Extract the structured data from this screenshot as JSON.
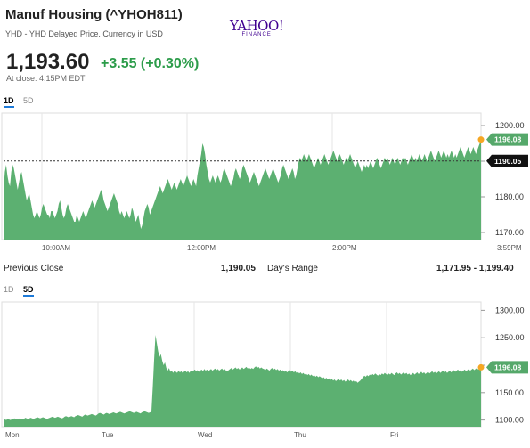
{
  "header": {
    "title": "Manuf Housing (^YHOH811)",
    "subtitle": "YHD - YHD Delayed Price. Currency in USD",
    "logo_main": "YAHOO!",
    "logo_sub": "FINANCE"
  },
  "quote": {
    "price": "1,193.60",
    "change": "+3.55 (+0.30%)",
    "close_text": "At close: 4:15PM EDT"
  },
  "tabs_top": [
    "1D",
    "5D"
  ],
  "tabs_bottom": [
    "1D",
    "5D"
  ],
  "stats": {
    "prev_close_label": "Previous Close",
    "prev_close_value": "1,190.05",
    "days_range_label": "Day's Range",
    "days_range_value": "1,171.95 - 1,199.40"
  },
  "colors": {
    "fill": "#5cb071",
    "positive": "#2c9c4a",
    "tab_accent": "#1d7ad8",
    "marker": "#f5a623",
    "label_bg": "#55a86a"
  },
  "chart_data": [
    {
      "type": "area",
      "range_label": "1D",
      "x_tick_labels": [
        "10:00AM",
        "12:00PM",
        "2:00PM",
        "3:59PM"
      ],
      "y_tick_labels": [
        "1200.00",
        "1190.00",
        "1180.00",
        "1170.00"
      ],
      "ylim": [
        1168,
        1203
      ],
      "last_value_label": "1196.08",
      "prev_close_label": "1190.05",
      "prev_close": 1190.05,
      "x": [
        0,
        1,
        2,
        3,
        4,
        5,
        6,
        7,
        8,
        9,
        10,
        11,
        12,
        13,
        14,
        15,
        16,
        17,
        18,
        19,
        20,
        21,
        22,
        23,
        24,
        25,
        26,
        27,
        28,
        29,
        30,
        31,
        32,
        33,
        34,
        35,
        36,
        37,
        38,
        39,
        40,
        41,
        42,
        43,
        44,
        45,
        46,
        47,
        48,
        49,
        50,
        51,
        52,
        53,
        54,
        55,
        56,
        57,
        58,
        59,
        60,
        61,
        62,
        63,
        64,
        65,
        66,
        67,
        68,
        69,
        70,
        71,
        72,
        73,
        74,
        75,
        76,
        77,
        78,
        79,
        80,
        81,
        82,
        83,
        84,
        85,
        86,
        87,
        88,
        89,
        90,
        91,
        92,
        93,
        94,
        95,
        96,
        97,
        98,
        99,
        100,
        101,
        102,
        103,
        104,
        105,
        106,
        107,
        108,
        109,
        110,
        111,
        112,
        113,
        114,
        115,
        116,
        117,
        118,
        119,
        120,
        121,
        122,
        123,
        124,
        125,
        126,
        127,
        128,
        129,
        130,
        131,
        132,
        133,
        134,
        135,
        136,
        137,
        138,
        139,
        140,
        141,
        142,
        143,
        144,
        145,
        146,
        147,
        148,
        149,
        150,
        151,
        152,
        153,
        154,
        155,
        156,
        157,
        158,
        159,
        160,
        161,
        162,
        163,
        164,
        165,
        166,
        167,
        168,
        169,
        170,
        171,
        172,
        173,
        174,
        175,
        176,
        177,
        178,
        179,
        180,
        181,
        182,
        183,
        184,
        185,
        186,
        187,
        188,
        189,
        190,
        191,
        192,
        193,
        194,
        195,
        196,
        197,
        198,
        199,
        200,
        201,
        202,
        203,
        204,
        205,
        206,
        207,
        208,
        209,
        210,
        211,
        212,
        213,
        214,
        215,
        216,
        217,
        218,
        219,
        220,
        221,
        222,
        223,
        224,
        225,
        226,
        227,
        228,
        229,
        230,
        231,
        232,
        233,
        234,
        235,
        236,
        237,
        238,
        239,
        240,
        241,
        242,
        243,
        244,
        245,
        246,
        247,
        248,
        249,
        250,
        251,
        252,
        253,
        254,
        255,
        256,
        257,
        258,
        259,
        260,
        261,
        262,
        263,
        264,
        265,
        266,
        267,
        268,
        269,
        270,
        271,
        272,
        273,
        274,
        275,
        276,
        277,
        278,
        279,
        280,
        281,
        282,
        283,
        284,
        285,
        286,
        287,
        288,
        289,
        290,
        291,
        292,
        293,
        294,
        295,
        296,
        297,
        298,
        299,
        300,
        301,
        302,
        303,
        304,
        305,
        306,
        307,
        308,
        309,
        310,
        311,
        312,
        313,
        314,
        315,
        316,
        317,
        318,
        319,
        320,
        321,
        322,
        323,
        324,
        325,
        326,
        327,
        328,
        329,
        330,
        331,
        332,
        333,
        334,
        335,
        336,
        337,
        338,
        339,
        340,
        341,
        342,
        343,
        344,
        345,
        346,
        347,
        348,
        349,
        350,
        351,
        352,
        353,
        354,
        355,
        356,
        357,
        358,
        359,
        360,
        361,
        362,
        363,
        364,
        365,
        366,
        367,
        368,
        369,
        370,
        371,
        372,
        373,
        374,
        375,
        376,
        377,
        378,
        379,
        380,
        381,
        382,
        383,
        384,
        385,
        386,
        387,
        388,
        389,
        390
      ],
      "values": [
        1182,
        1187,
        1189,
        1186,
        1184,
        1183,
        1187,
        1189,
        1188,
        1186,
        1184,
        1182,
        1184,
        1186,
        1187,
        1185,
        1183,
        1181,
        1179,
        1180,
        1181,
        1179,
        1177,
        1175,
        1174,
        1175,
        1176,
        1175,
        1174,
        1175,
        1177,
        1178,
        1177,
        1176,
        1175,
        1175,
        1174,
        1176,
        1176,
        1175,
        1174,
        1175,
        1176,
        1178,
        1179,
        1177,
        1175,
        1174,
        1175,
        1177,
        1178,
        1177,
        1176,
        1175,
        1174,
        1173,
        1173,
        1175,
        1174,
        1173,
        1174,
        1175,
        1176,
        1175,
        1174,
        1175,
        1176,
        1177,
        1178,
        1179,
        1178,
        1177,
        1178,
        1179,
        1180,
        1181,
        1182,
        1181,
        1179,
        1178,
        1177,
        1176,
        1177,
        1178,
        1179,
        1180,
        1181,
        1180,
        1179,
        1178,
        1176,
        1175,
        1176,
        1175,
        1174,
        1175,
        1176,
        1175,
        1174,
        1175,
        1177,
        1176,
        1174,
        1173,
        1174,
        1175,
        1173,
        1171,
        1172,
        1174,
        1176,
        1177,
        1178,
        1177,
        1175,
        1176,
        1177,
        1178,
        1179,
        1180,
        1181,
        1182,
        1183,
        1182,
        1181,
        1182,
        1183,
        1184,
        1185,
        1184,
        1183,
        1182,
        1183,
        1184,
        1183,
        1182,
        1183,
        1184,
        1185,
        1184,
        1183,
        1184,
        1185,
        1186,
        1185,
        1184,
        1183,
        1184,
        1185,
        1184,
        1183,
        1186,
        1188,
        1190,
        1192,
        1195,
        1194,
        1192,
        1189,
        1187,
        1185,
        1184,
        1185,
        1186,
        1185,
        1184,
        1185,
        1186,
        1185,
        1184,
        1185,
        1187,
        1188,
        1187,
        1186,
        1185,
        1184,
        1183,
        1184,
        1185,
        1187,
        1188,
        1187,
        1186,
        1185,
        1186,
        1188,
        1189,
        1188,
        1187,
        1186,
        1185,
        1184,
        1185,
        1186,
        1187,
        1186,
        1185,
        1184,
        1183,
        1184,
        1185,
        1186,
        1187,
        1188,
        1187,
        1186,
        1185,
        1186,
        1187,
        1188,
        1187,
        1186,
        1185,
        1184,
        1185,
        1186,
        1188,
        1189,
        1188,
        1187,
        1186,
        1185,
        1186,
        1187,
        1188,
        1187,
        1185,
        1186,
        1188,
        1190,
        1191,
        1190,
        1191,
        1192,
        1191,
        1190,
        1191,
        1192,
        1191,
        1190,
        1189,
        1188,
        1189,
        1190,
        1191,
        1190,
        1189,
        1190,
        1191,
        1192,
        1191,
        1190,
        1189,
        1190,
        1191,
        1192,
        1193,
        1192,
        1191,
        1190,
        1191,
        1192,
        1191,
        1190,
        1189,
        1190,
        1191,
        1190,
        1191,
        1192,
        1191,
        1190,
        1189,
        1188,
        1189,
        1190,
        1189,
        1188,
        1187,
        1188,
        1189,
        1188,
        1189,
        1188,
        1189,
        1190,
        1189,
        1188,
        1189,
        1190,
        1191,
        1190,
        1189,
        1188,
        1189,
        1190,
        1191,
        1190,
        1191,
        1190,
        1189,
        1190,
        1191,
        1190,
        1189,
        1190,
        1191,
        1190,
        1189,
        1190,
        1191,
        1190,
        1191,
        1190,
        1189,
        1190,
        1191,
        1192,
        1191,
        1190,
        1191,
        1190,
        1191,
        1192,
        1191,
        1190,
        1191,
        1192,
        1191,
        1190,
        1191,
        1192,
        1193,
        1192,
        1191,
        1190,
        1191,
        1192,
        1193,
        1192,
        1191,
        1192,
        1193,
        1192,
        1191,
        1192,
        1191,
        1192,
        1193,
        1192,
        1191,
        1192,
        1191,
        1192,
        1193,
        1194,
        1193,
        1192,
        1191,
        1192,
        1193,
        1194,
        1193,
        1192,
        1193,
        1194,
        1193,
        1192,
        1193,
        1194,
        1195,
        1196.08
      ]
    },
    {
      "type": "area",
      "range_label": "5D",
      "x_tick_labels": [
        "Mon",
        "Tue",
        "Wed",
        "Thu",
        "Fri"
      ],
      "y_tick_labels": [
        "1300.00",
        "1250.00",
        "1200.00",
        "1150.00",
        "1100.00"
      ],
      "ylim": [
        1088,
        1312
      ],
      "last_value_label": "1196.08",
      "values": [
        1100,
        1101,
        1100,
        1102,
        1101,
        1100,
        1101,
        1102,
        1103,
        1102,
        1101,
        1102,
        1103,
        1102,
        1101,
        1102,
        1104,
        1103,
        1102,
        1103,
        1104,
        1103,
        1102,
        1103,
        1104,
        1105,
        1104,
        1103,
        1104,
        1105,
        1104,
        1103,
        1102,
        1103,
        1104,
        1105,
        1106,
        1105,
        1104,
        1105,
        1106,
        1105,
        1104,
        1103,
        1104,
        1106,
        1107,
        1106,
        1105,
        1106,
        1107,
        1106,
        1105,
        1107,
        1108,
        1109,
        1108,
        1107,
        1106,
        1108,
        1110,
        1109,
        1108,
        1109,
        1110,
        1111,
        1110,
        1109,
        1108,
        1110,
        1112,
        1113,
        1112,
        1111,
        1110,
        1112,
        1113,
        1112,
        1111,
        1112,
        1113,
        1114,
        1113,
        1112,
        1113,
        1114,
        1115,
        1114,
        1113,
        1112,
        1113,
        1114,
        1115,
        1116,
        1115,
        1114,
        1113,
        1114,
        1115,
        1114,
        1113,
        1112,
        1114,
        1115,
        1116,
        1115,
        1114,
        1113,
        1114,
        1115,
        1160,
        1210,
        1255,
        1240,
        1225,
        1215,
        1220,
        1208,
        1200,
        1205,
        1195,
        1190,
        1195,
        1188,
        1190,
        1186,
        1190,
        1188,
        1186,
        1190,
        1187,
        1189,
        1186,
        1188,
        1190,
        1187,
        1189,
        1186,
        1190,
        1188,
        1190,
        1192,
        1189,
        1191,
        1188,
        1190,
        1192,
        1189,
        1193,
        1190,
        1192,
        1189,
        1191,
        1193,
        1190,
        1192,
        1194,
        1191,
        1193,
        1190,
        1192,
        1194,
        1191,
        1193,
        1190,
        1189,
        1191,
        1193,
        1195,
        1192,
        1194,
        1196,
        1193,
        1195,
        1192,
        1194,
        1196,
        1193,
        1195,
        1197,
        1194,
        1196,
        1193,
        1195,
        1193,
        1196,
        1198,
        1195,
        1197,
        1194,
        1196,
        1194,
        1193,
        1191,
        1194,
        1192,
        1190,
        1193,
        1195,
        1192,
        1194,
        1191,
        1193,
        1190,
        1192,
        1189,
        1191,
        1188,
        1190,
        1187,
        1189,
        1191,
        1188,
        1190,
        1187,
        1189,
        1186,
        1188,
        1185,
        1187,
        1184,
        1186,
        1183,
        1185,
        1182,
        1184,
        1181,
        1183,
        1180,
        1182,
        1179,
        1181,
        1178,
        1180,
        1178,
        1176,
        1178,
        1175,
        1177,
        1174,
        1176,
        1173,
        1175,
        1172,
        1174,
        1171,
        1173,
        1175,
        1172,
        1174,
        1171,
        1173,
        1170,
        1172,
        1174,
        1171,
        1173,
        1170,
        1172,
        1169,
        1171,
        1168,
        1170,
        1172,
        1175,
        1178,
        1181,
        1179,
        1182,
        1180,
        1183,
        1181,
        1184,
        1182,
        1185,
        1183,
        1181,
        1184,
        1182,
        1185,
        1183,
        1186,
        1184,
        1182,
        1185,
        1183,
        1186,
        1184,
        1182,
        1185,
        1187,
        1184,
        1186,
        1183,
        1185,
        1187,
        1184,
        1186,
        1183,
        1185,
        1182,
        1184,
        1186,
        1183,
        1185,
        1187,
        1184,
        1186,
        1188,
        1185,
        1187,
        1184,
        1186,
        1188,
        1185,
        1187,
        1189,
        1186,
        1188,
        1185,
        1187,
        1189,
        1186,
        1188,
        1190,
        1187,
        1189,
        1186,
        1188,
        1190,
        1187,
        1189,
        1191,
        1188,
        1190,
        1192,
        1189,
        1191,
        1188,
        1190,
        1192,
        1189,
        1191,
        1193,
        1190,
        1192,
        1194,
        1191,
        1193,
        1195,
        1192,
        1194,
        1196.08
      ]
    }
  ]
}
